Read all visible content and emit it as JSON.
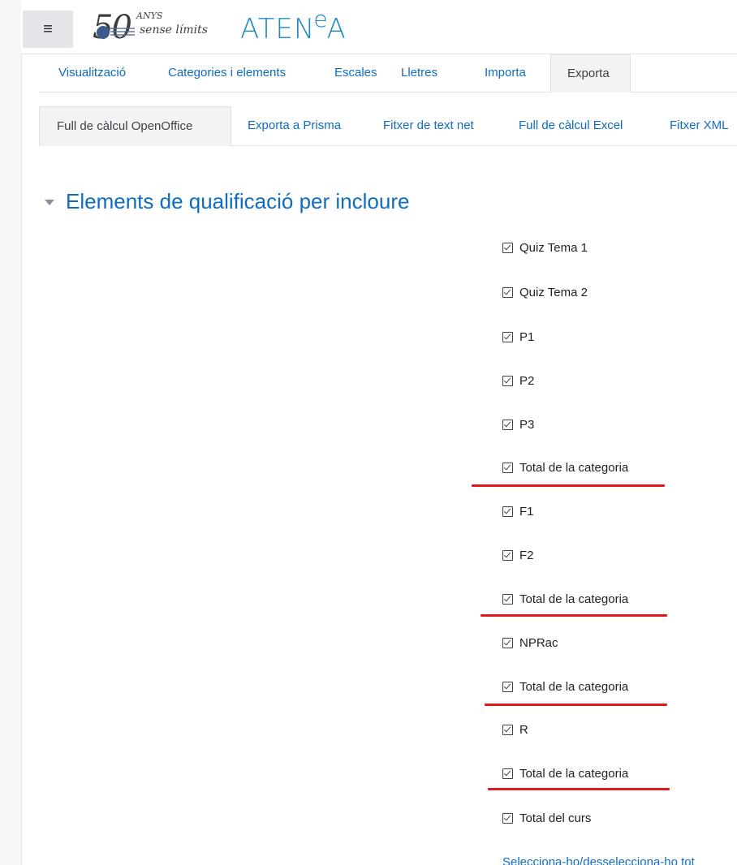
{
  "header": {
    "menu_icon": "hamburger-menu-icon",
    "logo_number": "50",
    "logo_anys": "ANYS",
    "logo_tagline": "sense límits",
    "app_name_prefix": "ATEN",
    "app_name_sup": "e",
    "app_name_suffix": "A"
  },
  "main_tabs": [
    {
      "label": "Visualització",
      "active": false
    },
    {
      "label": "Categories i elements",
      "active": false
    },
    {
      "label": "Escales",
      "active": false
    },
    {
      "label": "Lletres",
      "active": false
    },
    {
      "label": "Importa",
      "active": false
    },
    {
      "label": "Exporta",
      "active": true
    }
  ],
  "sub_tabs": [
    {
      "label": "Full de càlcul OpenOffice",
      "active": true
    },
    {
      "label": "Exporta a Prisma",
      "active": false
    },
    {
      "label": "Fitxer de text net",
      "active": false
    },
    {
      "label": "Full de càlcul Excel",
      "active": false
    },
    {
      "label": "Fitxer XML",
      "active": false
    }
  ],
  "section": {
    "title": "Elements de qualificació per incloure",
    "collapse_icon": "caret-down-icon"
  },
  "items": [
    {
      "label": "Quiz Tema 1",
      "checked": true,
      "highlighted": false
    },
    {
      "label": "Quiz Tema 2",
      "checked": true,
      "highlighted": false
    },
    {
      "label": "P1",
      "checked": true,
      "highlighted": false
    },
    {
      "label": "P2",
      "checked": true,
      "highlighted": false
    },
    {
      "label": "P3",
      "checked": true,
      "highlighted": false
    },
    {
      "label": "Total de la categoria",
      "checked": true,
      "highlighted": true
    },
    {
      "label": "F1",
      "checked": true,
      "highlighted": false
    },
    {
      "label": "F2",
      "checked": true,
      "highlighted": false
    },
    {
      "label": "Total de la categoria",
      "checked": true,
      "highlighted": true
    },
    {
      "label": "NPRac",
      "checked": true,
      "highlighted": false
    },
    {
      "label": "Total de la categoria",
      "checked": true,
      "highlighted": true
    },
    {
      "label": "R",
      "checked": true,
      "highlighted": false
    },
    {
      "label": "Total de la categoria",
      "checked": true,
      "highlighted": true
    },
    {
      "label": "Total del curs",
      "checked": true,
      "highlighted": false
    }
  ],
  "select_all_link": "Selecciona-ho/desselecciona-ho tot",
  "colors": {
    "link": "#0f6cbf",
    "brand": "#1f8ac8",
    "highlight_underline": "#e01a1a"
  }
}
